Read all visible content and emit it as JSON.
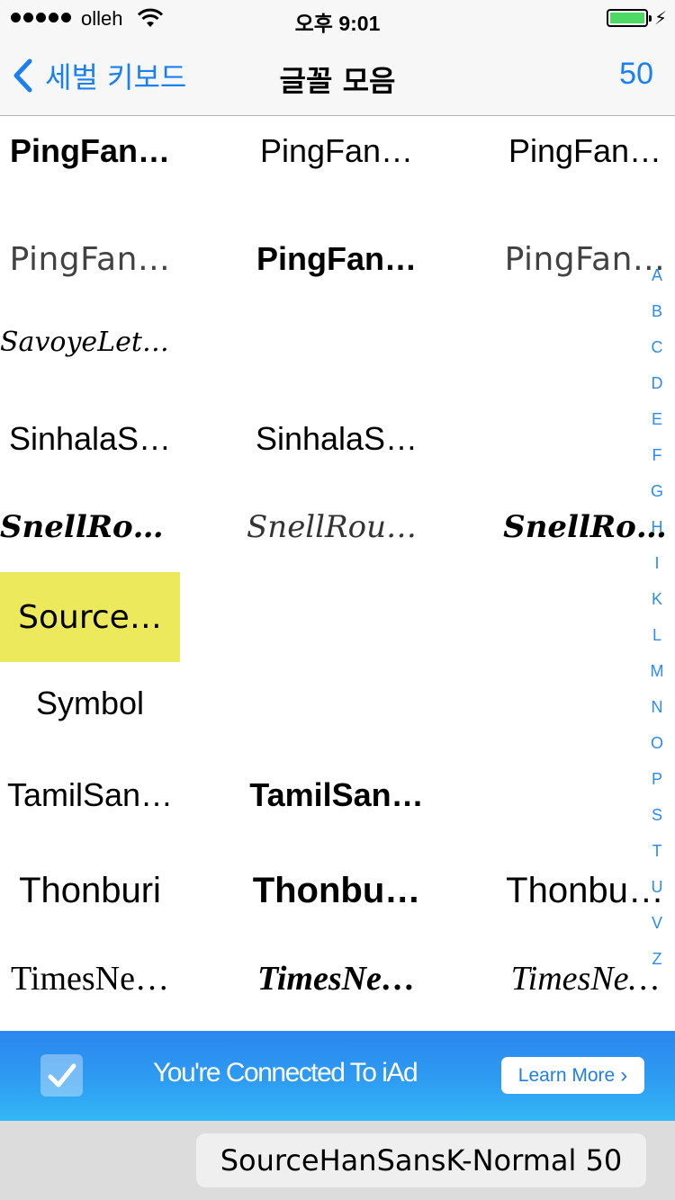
{
  "status_bar": {
    "carrier": "olleh",
    "time": "오후 9:01",
    "battery_level": 1.0,
    "battery_color": "#4cd964",
    "icons": [
      "signal-dots-icon",
      "wifi-icon",
      "battery-icon",
      "charging-bolt-icon"
    ]
  },
  "nav": {
    "back_label": "세벌 키보드",
    "title": "글꼴 모음",
    "count": "50",
    "accent_color": "#1a7ff0"
  },
  "grid": {
    "rows": [
      {
        "cells": [
          {
            "label": "PingFan…",
            "style": "bold"
          },
          {
            "label": "PingFan…",
            "style": "sans"
          },
          {
            "label": "PingFan…",
            "style": "sans"
          }
        ]
      },
      {
        "cells": [
          {
            "label": "PingFan…",
            "style": "light"
          },
          {
            "label": "PingFan…",
            "style": "bold"
          },
          {
            "label": "PingFan…",
            "style": "light"
          }
        ]
      },
      {
        "cells": [
          {
            "label": "SavoyeLetPlain",
            "style": "script"
          }
        ]
      },
      {
        "cells": [
          {
            "label": "SinhalaS…",
            "style": "sans"
          },
          {
            "label": "SinhalaS…",
            "style": "sans"
          }
        ]
      },
      {
        "cells": [
          {
            "label": "SnellRou…",
            "style": "script-bold"
          },
          {
            "label": "SnellRoun…",
            "style": "script-light"
          },
          {
            "label": "SnellRo…",
            "style": "script-bold"
          }
        ]
      },
      {
        "cells": [
          {
            "label": "Source…",
            "style": "source",
            "selected": true
          }
        ]
      },
      {
        "cells": [
          {
            "label": "Symbol",
            "style": "sans"
          }
        ]
      },
      {
        "cells": [
          {
            "label": "TamilSan…",
            "style": "sans"
          },
          {
            "label": "TamilSan…",
            "style": "bold"
          }
        ]
      },
      {
        "cells": [
          {
            "label": "Thonburi",
            "style": "sans"
          },
          {
            "label": "Thonbu…",
            "style": "bold"
          },
          {
            "label": "Thonbu…",
            "style": "sans"
          }
        ]
      },
      {
        "cells": [
          {
            "label": "TimesNe…",
            "style": "serif"
          },
          {
            "label": "TimesNe…",
            "style": "serif-bold-italic"
          },
          {
            "label": "TimesNe…",
            "style": "serif-italic"
          }
        ]
      }
    ],
    "highlight_color": "#ede95d"
  },
  "index": {
    "letters": [
      "A",
      "B",
      "C",
      "D",
      "E",
      "F",
      "G",
      "H",
      "I",
      "K",
      "L",
      "M",
      "N",
      "O",
      "P",
      "S",
      "T",
      "U",
      "V",
      "Z"
    ],
    "color": "#2a8bf2"
  },
  "ad": {
    "text": "You're Connected To iAd",
    "button_label": "Learn More",
    "button_chevron": "›"
  },
  "bottom": {
    "selected_font": "SourceHanSansK-Normal 50"
  }
}
